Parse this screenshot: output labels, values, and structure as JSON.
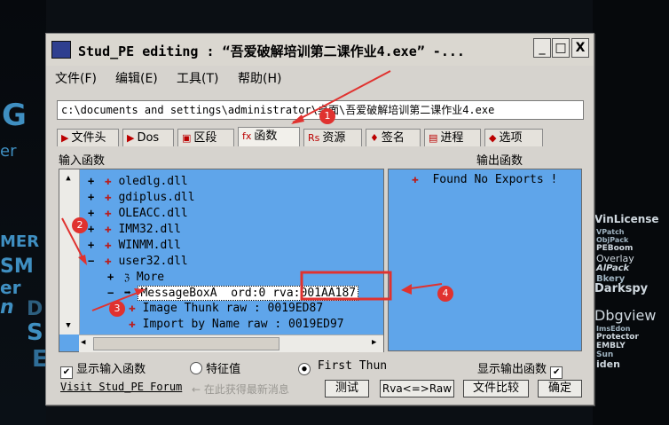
{
  "window": {
    "title": "Stud_PE editing : “吾爱破解培训第二课作业4.exe” -...",
    "min_label": "_",
    "max_label": "□",
    "close_label": "X"
  },
  "menu": [
    "文件(F)",
    "编辑(E)",
    "工具(T)",
    "帮助(H)"
  ],
  "path": "c:\\documents and settings\\administrator\\桌面\\吾爱破解培训第二课作业4.exe",
  "tabs": [
    {
      "icon": "▶",
      "label": "文件头"
    },
    {
      "icon": "▶",
      "label": "Dos"
    },
    {
      "icon": "▣",
      "label": "区段"
    },
    {
      "icon": "fx",
      "label": "函数"
    },
    {
      "icon": "Rs",
      "label": "资源"
    },
    {
      "icon": "♦",
      "label": "签名"
    },
    {
      "icon": "▤",
      "label": "进程"
    },
    {
      "icon": "◆",
      "label": "选项"
    }
  ],
  "import_label": "输入函数",
  "export_label": "输出函数",
  "tree": {
    "dlls": [
      "oledlg.dll",
      "gdiplus.dll",
      "OLEACC.dll",
      "IMM32.dll",
      "WINMM.dll",
      "user32.dll"
    ],
    "more_label": "More",
    "function_name": "MessageBoxA",
    "function_ord": "ord:0 rva:",
    "function_rva": "001AA187",
    "thunk_label": "Image Thunk raw : 0019ED87",
    "byname_label": "Import by Name raw : 0019ED97"
  },
  "exports": [
    "Found No Exports !"
  ],
  "bottom": {
    "show_import": "显示输入函数",
    "feature": "特征值",
    "first_thunk": "First Thun",
    "show_export": "显示输出函数",
    "visit_link": "Visit Stud_PE Forum",
    "hint": "← 在此获得最新消息",
    "test_button": "测试",
    "rva_button": "Rva<=>Raw",
    "compare_button": "文件比较",
    "ok_button": "确定"
  },
  "annotations": [
    "1",
    "2",
    "3",
    "4"
  ],
  "background": {
    "left_text": [
      "G",
      "er",
      "MER",
      "SM",
      "er",
      "n",
      "D",
      "S",
      "E"
    ],
    "right_text": [
      "VinLicense",
      "VPatch",
      "ObjPack",
      "PEBoom",
      "Overlay",
      "AlPack",
      "Bkery",
      "Darkspy",
      "Dbgview",
      "ImsEdon",
      "Protector",
      "EMBLY",
      "Sun",
      "iden"
    ]
  },
  "colors": {
    "panel_bg": "#5fa5ea",
    "annotation": "#e0322f"
  }
}
